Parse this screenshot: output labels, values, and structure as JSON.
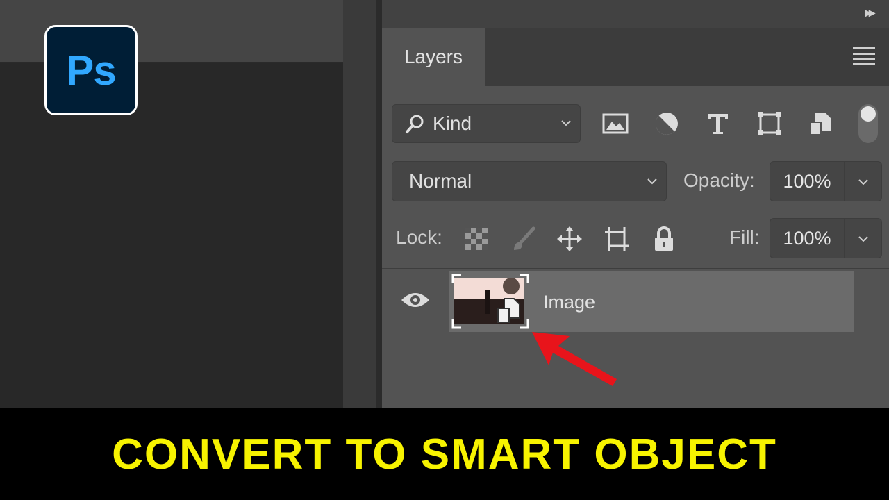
{
  "app": {
    "logo_text": "Ps"
  },
  "layers_panel": {
    "tab_label": "Layers",
    "filter": {
      "kind_label": "Kind",
      "icons": [
        "image-filter-icon",
        "adjustment-filter-icon",
        "type-filter-icon",
        "shape-filter-icon",
        "smart-object-filter-icon"
      ]
    },
    "blend_mode": "Normal",
    "opacity_label": "Opacity:",
    "opacity_value": "100%",
    "lock_label": "Lock:",
    "lock_icons": [
      "lock-transparent-pixels-icon",
      "lock-image-pixels-icon",
      "lock-position-icon",
      "lock-artboard-icon",
      "lock-all-icon"
    ],
    "fill_label": "Fill:",
    "fill_value": "100%",
    "layers": [
      {
        "name": "Image",
        "visible": true,
        "type": "smart-object"
      }
    ]
  },
  "caption": {
    "text": "CONVERT TO SMART OBJECT",
    "color": "#f7f300"
  },
  "colors": {
    "ps_blue": "#31a8ff",
    "ps_navy": "#001e36",
    "arrow_red": "#e8141b"
  }
}
